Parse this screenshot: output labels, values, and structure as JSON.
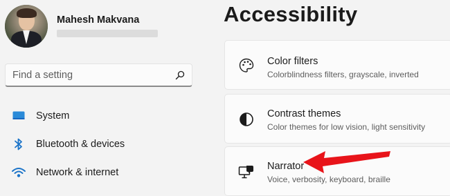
{
  "profile": {
    "name": "Mahesh Makvana"
  },
  "search": {
    "placeholder": "Find a setting"
  },
  "nav": [
    {
      "label": "System",
      "icon": "monitor-icon"
    },
    {
      "label": "Bluetooth & devices",
      "icon": "bluetooth-icon"
    },
    {
      "label": "Network & internet",
      "icon": "wifi-icon"
    }
  ],
  "page": {
    "title": "Accessibility"
  },
  "cards": [
    {
      "title": "Color filters",
      "subtitle": "Colorblindness filters, grayscale, inverted",
      "icon": "palette-icon"
    },
    {
      "title": "Contrast themes",
      "subtitle": "Color themes for low vision, light sensitivity",
      "icon": "contrast-icon"
    },
    {
      "title": "Narrator",
      "subtitle": "Voice, verbosity, keyboard, braille",
      "icon": "narrator-icon"
    }
  ],
  "colors": {
    "accent": "#0078d4",
    "annotation_arrow": "#e8141a",
    "background": "#f3f3f3",
    "card": "#fbfbfb"
  }
}
